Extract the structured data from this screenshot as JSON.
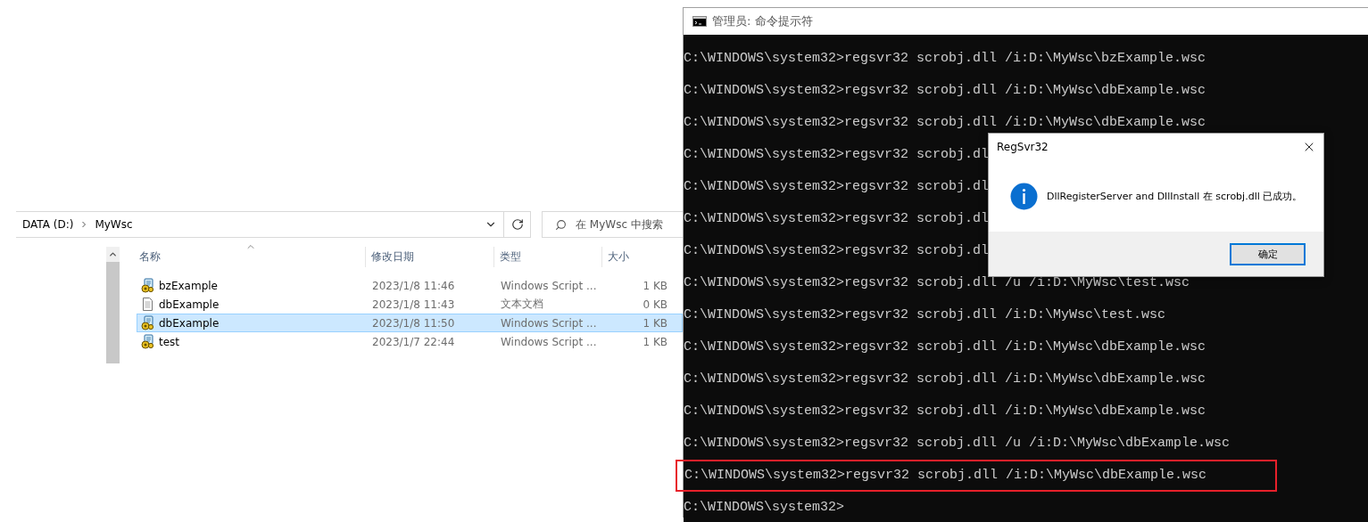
{
  "explorer": {
    "breadcrumb": [
      {
        "label": "DATA (D:)"
      },
      {
        "label": "MyWsc"
      }
    ],
    "search": {
      "placeholder": "在 MyWsc 中搜索"
    },
    "columns": [
      {
        "label": "名称",
        "sorted": true
      },
      {
        "label": "修改日期",
        "sorted": false
      },
      {
        "label": "类型",
        "sorted": false
      },
      {
        "label": "大小",
        "sorted": false
      }
    ],
    "rows": [
      {
        "name": "bzExample",
        "date": "2023/1/8 11:46",
        "type": "Windows Script ...",
        "size": "1 KB",
        "kind": "script",
        "selected": false
      },
      {
        "name": "dbExample",
        "date": "2023/1/8 11:43",
        "type": "文本文档",
        "size": "0 KB",
        "kind": "text",
        "selected": false
      },
      {
        "name": "dbExample",
        "date": "2023/1/8 11:50",
        "type": "Windows Script ...",
        "size": "1 KB",
        "kind": "script",
        "selected": true
      },
      {
        "name": "test",
        "date": "2023/1/7 22:44",
        "type": "Windows Script ...",
        "size": "1 KB",
        "kind": "script",
        "selected": false
      }
    ]
  },
  "console": {
    "title": "管理员: 命令提示符",
    "lines": [
      {
        "text": "C:\\WINDOWS\\system32>regsvr32 scrobj.dll /i:D:\\MyWsc\\bzExample.wsc",
        "highlighted": false
      },
      {
        "text": "C:\\WINDOWS\\system32>regsvr32 scrobj.dll /i:D:\\MyWsc\\dbExample.wsc",
        "highlighted": false
      },
      {
        "text": "C:\\WINDOWS\\system32>regsvr32 scrobj.dll /i:D:\\MyWsc\\dbExample.wsc",
        "highlighted": false
      },
      {
        "text": "C:\\WINDOWS\\system32>regsvr32 scrobj.dl",
        "highlighted": false
      },
      {
        "text": "C:\\WINDOWS\\system32>regsvr32 scrobj.dl",
        "highlighted": false
      },
      {
        "text": "C:\\WINDOWS\\system32>regsvr32 scrobj.dl",
        "highlighted": false
      },
      {
        "text": "C:\\WINDOWS\\system32>regsvr32 scrobj.dl",
        "highlighted": false
      },
      {
        "text": "C:\\WINDOWS\\system32>regsvr32 scrobj.dll /u /i:D:\\MyWsc\\test.wsc",
        "highlighted": false
      },
      {
        "text": "C:\\WINDOWS\\system32>regsvr32 scrobj.dll /i:D:\\MyWsc\\test.wsc",
        "highlighted": false
      },
      {
        "text": "C:\\WINDOWS\\system32>regsvr32 scrobj.dll /i:D:\\MyWsc\\dbExample.wsc",
        "highlighted": false
      },
      {
        "text": "C:\\WINDOWS\\system32>regsvr32 scrobj.dll /i:D:\\MyWsc\\dbExample.wsc",
        "highlighted": false
      },
      {
        "text": "C:\\WINDOWS\\system32>regsvr32 scrobj.dll /i:D:\\MyWsc\\dbExample.wsc",
        "highlighted": false
      },
      {
        "text": "C:\\WINDOWS\\system32>regsvr32 scrobj.dll /u /i:D:\\MyWsc\\dbExample.wsc",
        "highlighted": false
      },
      {
        "text": "C:\\WINDOWS\\system32>regsvr32 scrobj.dll /i:D:\\MyWsc\\dbExample.wsc",
        "highlighted": true
      },
      {
        "text": "C:\\WINDOWS\\system32>",
        "highlighted": false
      }
    ]
  },
  "dialog": {
    "title": "RegSvr32",
    "message": "DllRegisterServer and DllInstall 在 scrobj.dll 已成功。",
    "buttons": [
      {
        "label": "确定",
        "focused": true
      }
    ]
  }
}
